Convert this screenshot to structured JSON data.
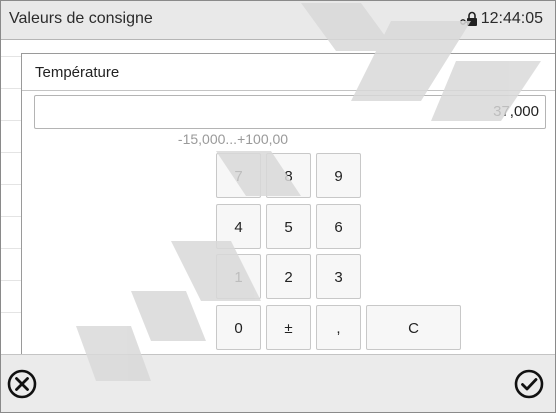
{
  "header": {
    "title": "Valeurs de consigne",
    "time": "12:44:05",
    "lock_icon": "lock-key-icon"
  },
  "dialog": {
    "title": "Température",
    "value": "37,000",
    "range": "-15,000...+100,00"
  },
  "keypad": {
    "rows": [
      [
        "7",
        "8",
        "9"
      ],
      [
        "4",
        "5",
        "6"
      ],
      [
        "1",
        "2",
        "3"
      ],
      [
        "0",
        "±",
        ",",
        "C"
      ]
    ]
  },
  "footer": {
    "cancel_icon": "close-circle-icon",
    "confirm_icon": "check-circle-icon"
  },
  "watermark": {
    "color": "#d9d9d9"
  }
}
